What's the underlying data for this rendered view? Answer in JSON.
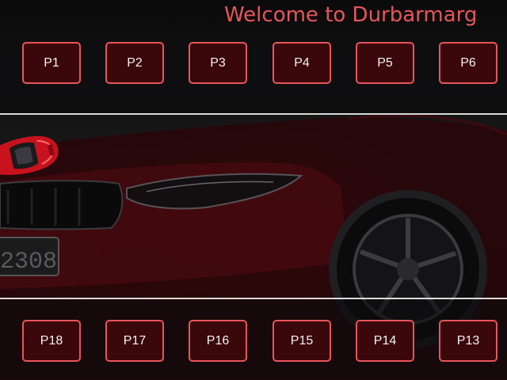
{
  "header": {
    "title": "Welcome to Durbarmarg"
  },
  "background": {
    "plate_text": "2308"
  },
  "top_row": {
    "slots": [
      "P1",
      "P2",
      "P3",
      "P4",
      "P5",
      "P6"
    ]
  },
  "bottom_row": {
    "slots": [
      "P18",
      "P17",
      "P16",
      "P15",
      "P14",
      "P13"
    ]
  },
  "colors": {
    "accent": "#e8555a",
    "slot_fill": "#3a070b",
    "divider": "#d9d9d9"
  },
  "icons": {
    "vehicle": "red-car-icon"
  }
}
